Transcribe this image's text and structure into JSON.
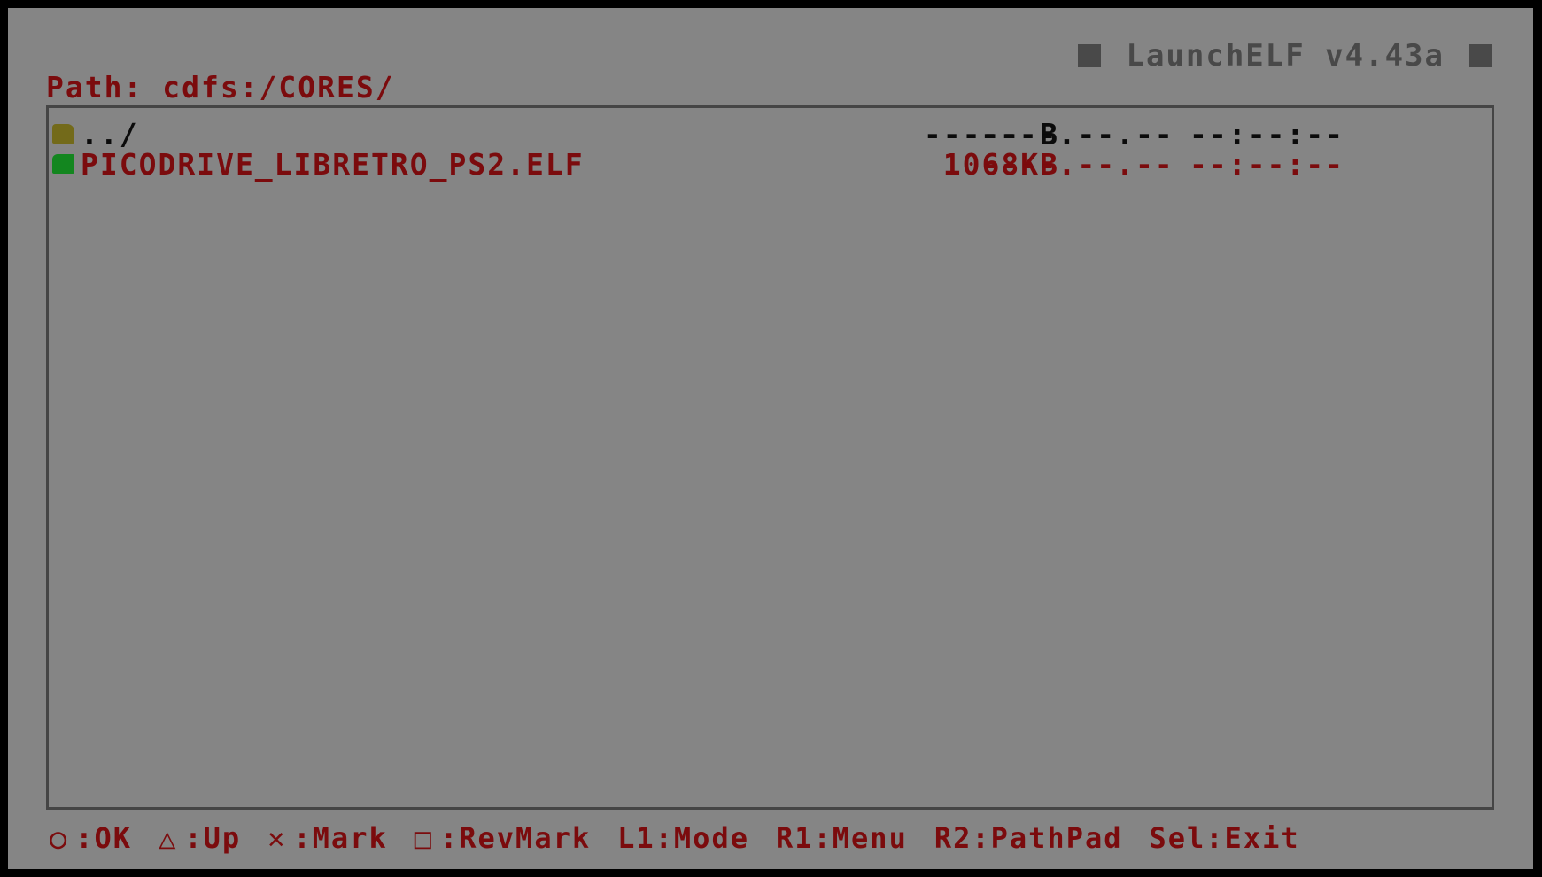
{
  "app": {
    "title": "LaunchELF v4.43a"
  },
  "path": {
    "label": "Path:",
    "value": "cdfs:/CORES/"
  },
  "files": [
    {
      "type": "folder",
      "icon": "folder-icon",
      "name": "../",
      "size": "----- B",
      "date": "----.--.--",
      "time": "--:--:--"
    },
    {
      "type": "file",
      "icon": "elf-file-icon",
      "name": "PICODRIVE_LIBRETRO_PS2.ELF",
      "size": "1068KB",
      "date": "----.--.--",
      "time": "--:--:--"
    }
  ],
  "footer": {
    "hints": [
      {
        "icon": "circle-button-icon",
        "glyph": "○",
        "label": ":OK"
      },
      {
        "icon": "triangle-button-icon",
        "glyph": "△",
        "label": ":Up"
      },
      {
        "icon": "cross-button-icon",
        "glyph": "✕",
        "label": ":Mark"
      },
      {
        "icon": "square-button-icon",
        "glyph": "□",
        "label": ":RevMark"
      },
      {
        "icon": "",
        "glyph": "",
        "label": "L1:Mode"
      },
      {
        "icon": "",
        "glyph": "",
        "label": "R1:Menu"
      },
      {
        "icon": "",
        "glyph": "",
        "label": "R2:PathPad"
      },
      {
        "icon": "",
        "glyph": "",
        "label": "Sel:Exit"
      }
    ]
  },
  "colors": {
    "background": "#858585",
    "text": "#7b0b0d",
    "title": "#494949",
    "folder_icon": "#736a1a",
    "file_icon": "#13861f"
  }
}
